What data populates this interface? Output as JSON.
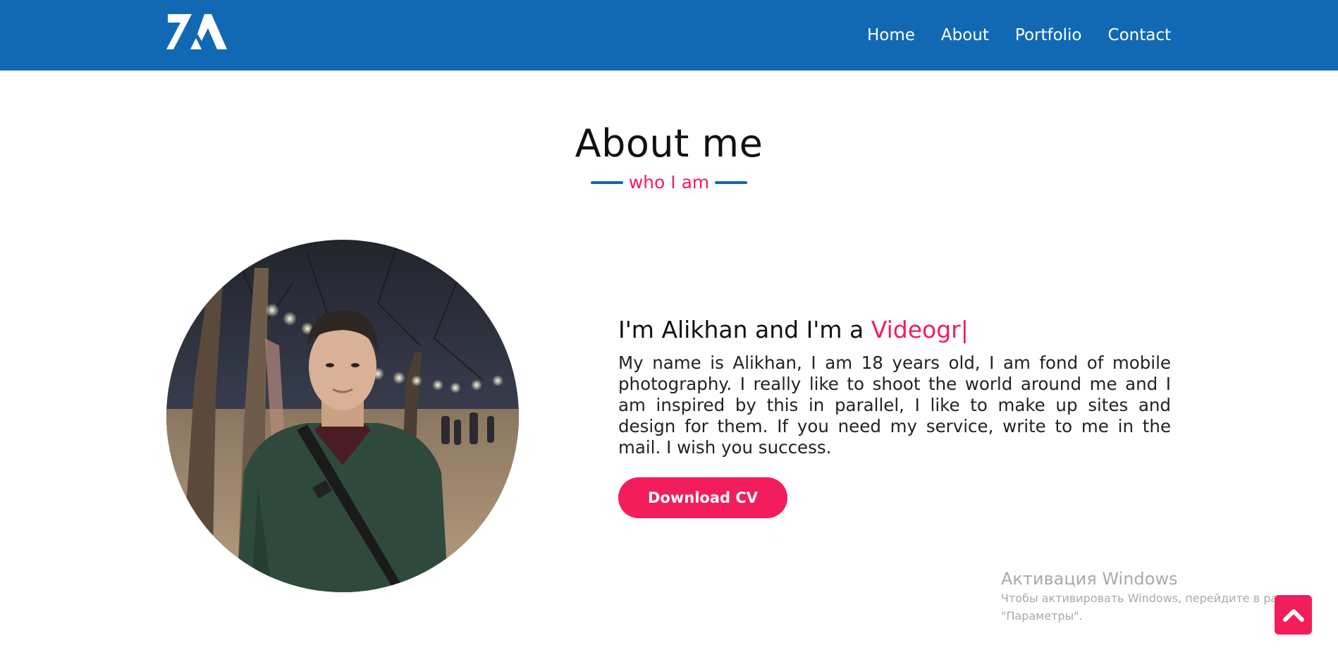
{
  "navbar": {
    "logo_icon": "za-logo-icon",
    "links": [
      {
        "label": "Home"
      },
      {
        "label": "About"
      },
      {
        "label": "Portfolio"
      },
      {
        "label": "Contact"
      }
    ],
    "background_color": "#1169b4"
  },
  "about": {
    "title": "About me",
    "subtitle": "who I am",
    "headline_prefix": "I'm Alikhan and I'm a ",
    "headline_typed": "Videogr|",
    "bio": "My name is Alikhan, I am 18 years old, I am fond of mobile photography. I really like to shoot the world around me and I am inspired by this in parallel, I like to make up sites and design for them. If you need my service, write to me in the mail. I wish you success.",
    "cv_button_label": "Download CV",
    "accent_color": "#f21d5a"
  },
  "watermark": {
    "title": "Активация Windows",
    "line1": "Чтобы активировать Windows, перейдите в раздел",
    "line2": "\"Параметры\"."
  },
  "scroll_top": {
    "icon": "chevron-up-icon"
  }
}
